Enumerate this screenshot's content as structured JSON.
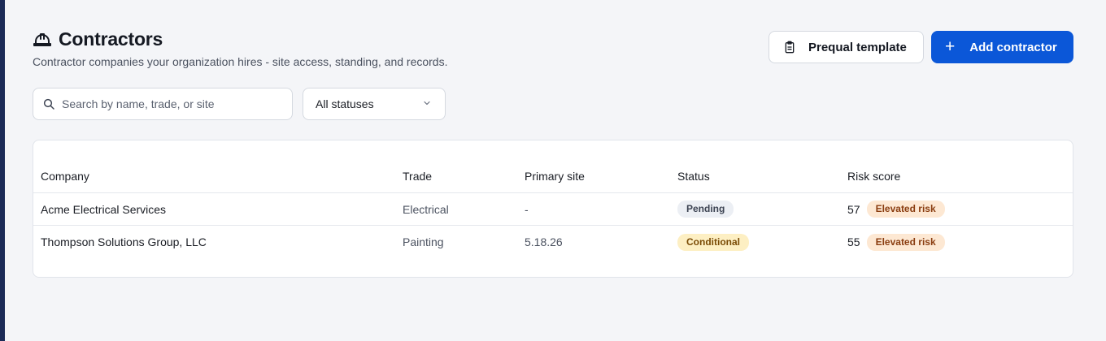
{
  "header": {
    "title": "Contractors",
    "subtitle": "Contractor companies your organization hires - site access, standing, and records.",
    "icon": "hard-hat-icon"
  },
  "actions": {
    "prequal_label": "Prequal template",
    "prequal_icon": "clipboard-icon",
    "add_label": "Add contractor",
    "add_icon": "plus-icon"
  },
  "filters": {
    "search_placeholder": "Search by name, trade, or site",
    "status_value": "All statuses"
  },
  "table": {
    "columns": [
      "Company",
      "Trade",
      "Primary site",
      "Status",
      "Risk score"
    ],
    "rows": [
      {
        "company": "Acme Electrical Services",
        "trade": "Electrical",
        "site": "-",
        "status": "Pending",
        "risk_score": "57",
        "risk_label": "Elevated risk"
      },
      {
        "company": "Thompson Solutions Group, LLC",
        "trade": "Painting",
        "site": "5.18.26",
        "status": "Conditional",
        "risk_score": "55",
        "risk_label": "Elevated risk"
      }
    ]
  },
  "colors": {
    "primary": "#0b57d8",
    "sidebar": "#1c2b57",
    "pending_bg": "#eceff4",
    "conditional_bg": "#fdefc3",
    "risk_bg": "#fde8d3"
  }
}
